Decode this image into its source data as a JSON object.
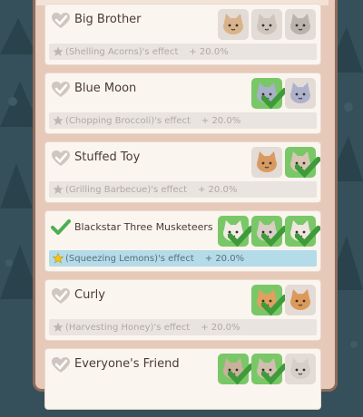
{
  "bonuses": [
    {
      "title": "Big Brother",
      "active": false,
      "effect_target": "(Shelling Acorns)",
      "effect_suffix": "'s effect",
      "effect_value": "+ 20.0%",
      "cats": [
        {
          "kind": "tabby",
          "color": "#d9b38c",
          "owned": false
        },
        {
          "kind": "tabby",
          "color": "#cfc5bd",
          "owned": false
        },
        {
          "kind": "tabby",
          "color": "#b9b3ad",
          "owned": false
        }
      ]
    },
    {
      "title": "Blue Moon",
      "active": false,
      "effect_target": "(Chopping Broccoli)",
      "effect_suffix": "'s effect",
      "effect_value": "+ 20.0%",
      "cats": [
        {
          "kind": "gray",
          "color": "#a9b0c9",
          "owned": true
        },
        {
          "kind": "gray",
          "color": "#aeb1cc",
          "owned": false
        }
      ]
    },
    {
      "title": "Stuffed Toy",
      "active": false,
      "effect_target": "(Grilling Barbecue)",
      "effect_suffix": "'s effect",
      "effect_value": "+ 20.0%",
      "cats": [
        {
          "kind": "orange",
          "color": "#d99a62",
          "owned": false
        },
        {
          "kind": "white-brown",
          "color": "#d8c6b4",
          "owned": true
        }
      ]
    },
    {
      "title": "Blackstar Three Musketeers",
      "active": true,
      "effect_target": "(Squeezing Lemons)",
      "effect_suffix": "'s effect",
      "effect_value": "+ 20.0%",
      "cats": [
        {
          "kind": "siamese",
          "color": "#f1ece6",
          "owned": true
        },
        {
          "kind": "siamese",
          "color": "#d9cfc6",
          "owned": true
        },
        {
          "kind": "siamese",
          "color": "#efe7df",
          "owned": true
        }
      ]
    },
    {
      "title": "Curly",
      "active": false,
      "effect_target": "(Harvesting Honey)",
      "effect_suffix": "'s effect",
      "effect_value": "+ 20.0%",
      "cats": [
        {
          "kind": "corgi",
          "color": "#e0a060",
          "owned": true
        },
        {
          "kind": "orange",
          "color": "#dc9a5a",
          "owned": false
        }
      ]
    },
    {
      "title": "Everyone's Friend",
      "active": false,
      "effect_target": "",
      "effect_suffix": "",
      "effect_value": "",
      "cats": [
        {
          "kind": "tabby",
          "color": "#c9b29c",
          "owned": true
        },
        {
          "kind": "tabby",
          "color": "#cfbfae",
          "owned": true
        },
        {
          "kind": "tabby",
          "color": "#d6cfc8",
          "owned": false
        }
      ]
    }
  ],
  "colors": {
    "owned_slot": "#7ac768",
    "empty_slot": "#e3dbd6",
    "active_effect": "#b4dbe8",
    "check_on": "#4caf50",
    "check_off": "#cfc6c0"
  }
}
